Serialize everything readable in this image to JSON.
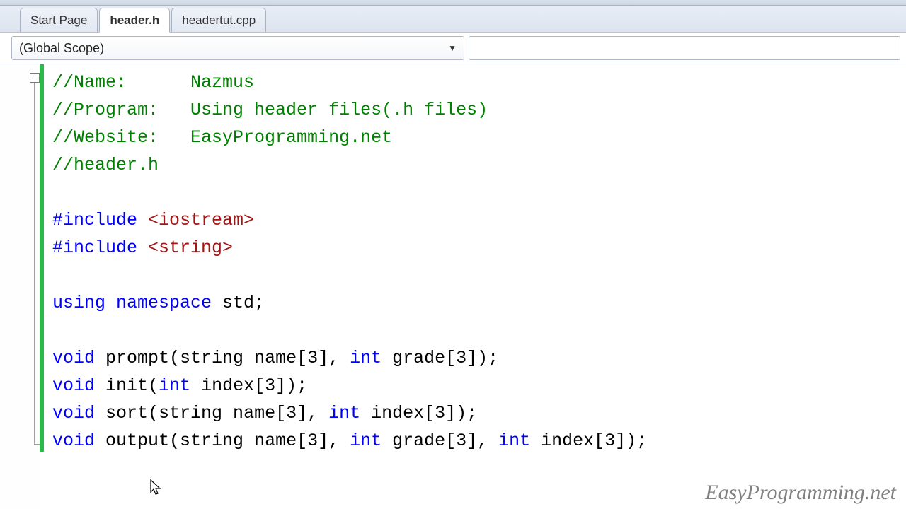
{
  "tabs": [
    {
      "label": "Start Page",
      "active": false
    },
    {
      "label": "header.h",
      "active": true
    },
    {
      "label": "headertut.cpp",
      "active": false
    }
  ],
  "scope": {
    "selected": "(Global Scope)"
  },
  "code": {
    "comments": {
      "name": "//Name:      Nazmus",
      "program": "//Program:   Using header files(.h files)",
      "website": "//Website:   EasyProgramming.net",
      "file": "//header.h"
    },
    "includes": {
      "kw1": "#include",
      "hdr1": " <iostream>",
      "kw2": "#include",
      "hdr2": " <string>"
    },
    "using": {
      "kw_using": "using",
      "kw_ns": " namespace",
      "tail": " std;"
    },
    "decls": {
      "void": "void",
      "sp": " ",
      "prompt_sig": "prompt(string name[3], ",
      "int": "int",
      "prompt_tail": " grade[3]);",
      "init_sig": "init(",
      "init_tail": " index[3]);",
      "sort_sig": "sort(string name[3], ",
      "sort_tail": " index[3]);",
      "output_sig": "output(string name[3], ",
      "output_mid": " grade[3], ",
      "output_tail": " index[3]);"
    }
  },
  "watermark": "EasyProgramming.net"
}
